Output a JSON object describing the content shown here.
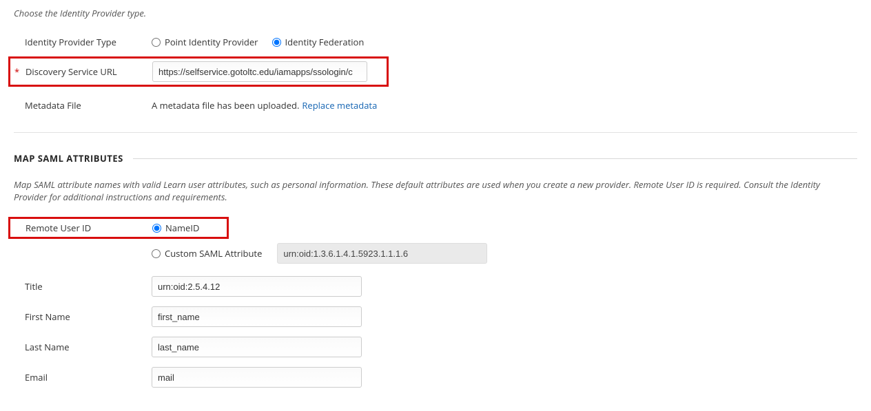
{
  "intro": "Choose the Identity Provider type.",
  "labels": {
    "idp_type": "Identity Provider Type",
    "discovery_url": "Discovery Service URL",
    "metadata_file": "Metadata File",
    "remote_user_id": "Remote User ID",
    "title": "Title",
    "first_name": "First Name",
    "last_name": "Last Name",
    "email": "Email"
  },
  "required_mark": "*",
  "idp_type": {
    "point": "Point Identity Provider",
    "federation": "Identity Federation"
  },
  "discovery_url_value": "https://selfservice.gotoltc.edu/iamapps/ssologin/c",
  "metadata": {
    "uploaded_text": "A metadata file has been uploaded.",
    "replace_link": "Replace metadata"
  },
  "section_title": "MAP SAML ATTRIBUTES",
  "section_intro": "Map SAML attribute names with valid Learn user attributes, such as personal information. These default attributes are used when you create a new provider. Remote User ID is required. Consult the Identity Provider for additional instructions and requirements.",
  "remote_user_id": {
    "nameid": "NameID",
    "custom_label": "Custom SAML Attribute",
    "custom_value": "urn:oid:1.3.6.1.4.1.5923.1.1.1.6"
  },
  "attrs": {
    "title_value": "urn:oid:2.5.4.12",
    "first_name_value": "first_name",
    "last_name_value": "last_name",
    "email_value": "mail"
  }
}
